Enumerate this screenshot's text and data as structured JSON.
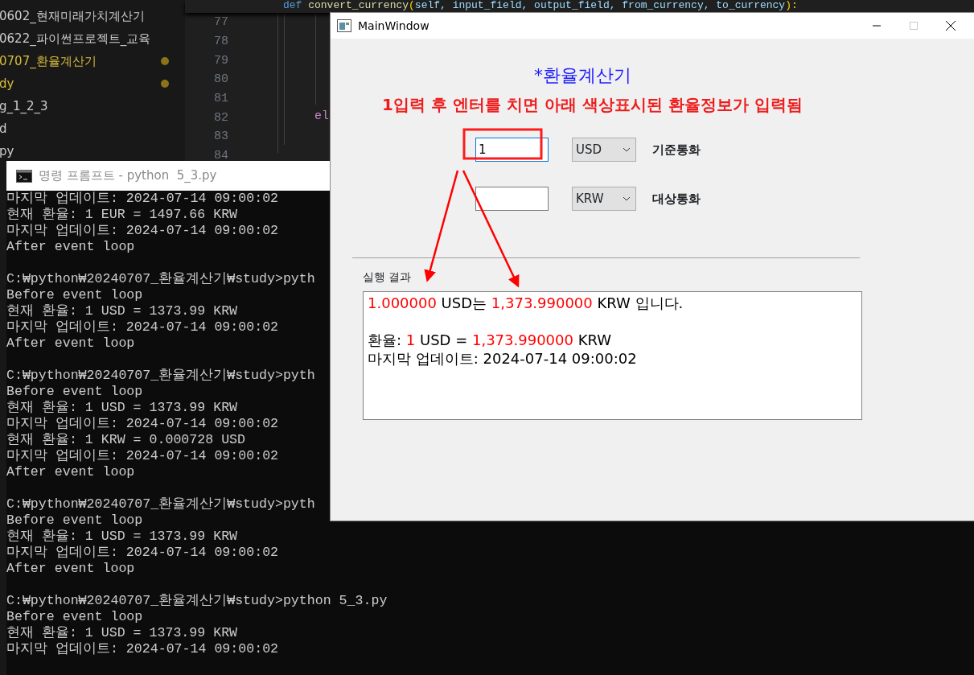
{
  "editor": {
    "code_top_line": [
      {
        "text": "def",
        "kind": "keyword"
      },
      {
        "text": "convert_currency",
        "kind": "function"
      },
      {
        "text": "(",
        "kind": "punct"
      },
      {
        "text": "self, input_field, output_field, from_currency, to_currency",
        "kind": "param"
      },
      {
        "text": "):",
        "kind": "punct"
      }
    ],
    "explorer_items": [
      {
        "label": "0602_현재미래가치계산기",
        "modified": false
      },
      {
        "label": "0622_파이썬프로젝트_교육",
        "modified": false
      },
      {
        "label": "0707_환율계산기",
        "modified": true
      },
      {
        "label": "dy",
        "modified": true
      },
      {
        "label": "g_1_2_3",
        "modified": false
      },
      {
        "label": "d",
        "modified": false
      },
      {
        "label": "py",
        "modified": false
      }
    ],
    "line_numbers": [
      "77",
      "78",
      "79",
      "80",
      "81",
      "82",
      "83",
      "84"
    ],
    "code_fragment": "el"
  },
  "terminal": {
    "title": "명령 프롬프트 - python  5_3.py",
    "blocks": [
      [
        "마지막 업데이트: 2024-07-14 09:00:02",
        "현재 환율: 1 EUR = 1497.66 KRW",
        "마지막 업데이트: 2024-07-14 09:00:02",
        "After event loop"
      ],
      [
        "C:₩python₩20240707_환율계산기₩study>pyth",
        "Before event loop",
        "현재 환율: 1 USD = 1373.99 KRW",
        "마지막 업데이트: 2024-07-14 09:00:02",
        "After event loop"
      ],
      [
        "C:₩python₩20240707_환율계산기₩study>pyth",
        "Before event loop",
        "현재 환율: 1 USD = 1373.99 KRW",
        "마지막 업데이트: 2024-07-14 09:00:02",
        "현재 환율: 1 KRW = 0.000728 USD",
        "마지막 업데이트: 2024-07-14 09:00:02",
        "After event loop"
      ],
      [
        "C:₩python₩20240707_환율계산기₩study>pyth",
        "Before event loop",
        "현재 환율: 1 USD = 1373.99 KRW",
        "마지막 업데이트: 2024-07-14 09:00:02",
        "After event loop"
      ],
      [
        "C:₩python₩20240707_환율계산기₩study>python 5_3.py",
        "Before event loop",
        "현재 환율: 1 USD = 1373.99 KRW",
        "마지막 업데이트: 2024-07-14 09:00:02"
      ]
    ]
  },
  "main_window": {
    "title": "MainWindow",
    "heading": "*환율계산기",
    "instruction": "1입력 후 엔터를 치면 아래 색상표시된 환율정보가 입력됨",
    "inputs": [
      {
        "value": "1",
        "focused": true,
        "currency": "USD",
        "label": "기준통화"
      },
      {
        "focused": false,
        "currency": "KRW",
        "label": "대상통화"
      }
    ],
    "result_label": "실행 결과",
    "result_blocks": [
      [
        [
          {
            "text": "1.000000",
            "highlight": true
          },
          {
            "text": " USD는 ",
            "highlight": false
          },
          {
            "text": "1,373.990000",
            "highlight": true
          },
          {
            "text": " KRW 입니다.",
            "highlight": false
          }
        ]
      ],
      [
        [
          {
            "text": "환율: ",
            "highlight": false
          },
          {
            "text": "1",
            "highlight": true
          },
          {
            "text": " USD = ",
            "highlight": false
          },
          {
            "text": "1,373.990000",
            "highlight": true
          },
          {
            "text": " KRW",
            "highlight": false
          }
        ],
        [
          {
            "text": "마지막 업데이트: 2024-07-14 09:00:02",
            "highlight": false
          }
        ]
      ]
    ]
  }
}
